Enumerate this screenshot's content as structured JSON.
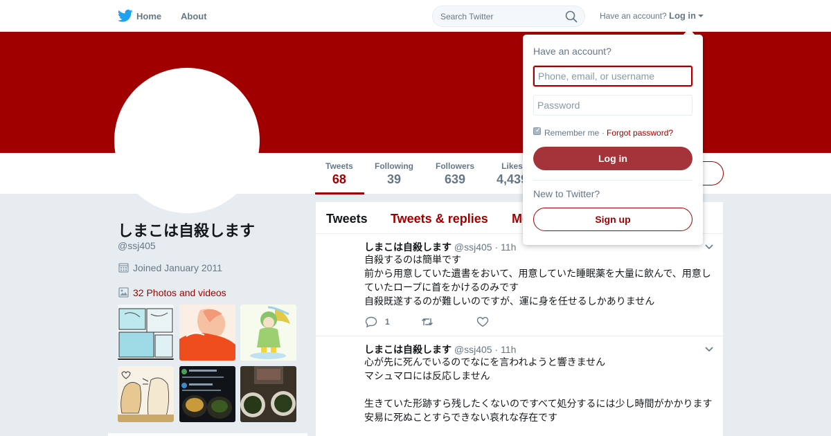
{
  "nav": {
    "home_label": "Home",
    "about_label": "About",
    "search_placeholder": "Search Twitter",
    "have_account": "Have an account?",
    "login_label": "Log in"
  },
  "profile": {
    "name": "しまこは自殺します",
    "handle": "@ssj405",
    "joined": "Joined January 2011",
    "photos_link": "32 Photos and videos"
  },
  "stats": {
    "tweets": {
      "label": "Tweets",
      "value": "68"
    },
    "following": {
      "label": "Following",
      "value": "39"
    },
    "followers": {
      "label": "Followers",
      "value": "639"
    },
    "likes": {
      "label": "Likes",
      "value": "4,439"
    }
  },
  "timeline": {
    "tabs": {
      "tweets": "Tweets",
      "replies": "Tweets & replies",
      "media": "Media"
    },
    "tweets": [
      {
        "name": "しまこは自殺します",
        "handle": "@ssj405",
        "sep": "·",
        "time": "11h",
        "lines": [
          "自殺するのは簡単です",
          "前から用意していた遺書をおいて、用意していた睡眠薬を大量に飲んで、用意し",
          "ていたロープに首をかけるのみです",
          "自殺既遂するのが難しいのですが、運に身を任せるしかありません"
        ],
        "reply_count": "1"
      },
      {
        "name": "しまこは自殺します",
        "handle": "@ssj405",
        "sep": "·",
        "time": "11h",
        "lines": [
          "心が先に死んでいるのでなにを言われようと響きません",
          "マシュマロには反応しません",
          "",
          "生きていた形跡すら残したくないのですべて処分するには少し時間がかかります",
          "安易に死ぬことすらできない哀れな存在です"
        ]
      }
    ]
  },
  "login_dropdown": {
    "title": "Have an account?",
    "username_placeholder": "Phone, email, or username",
    "password_placeholder": "Password",
    "remember_label": "Remember me",
    "separator": "·",
    "forgot_label": "Forgot password?",
    "login_button": "Log in",
    "new_label": "New to Twitter?",
    "signup_button": "Sign up"
  },
  "colors": {
    "theme": "#a10000",
    "login_button": "#a5343a",
    "muted_text": "#657786",
    "background": "#e6ecf0"
  }
}
